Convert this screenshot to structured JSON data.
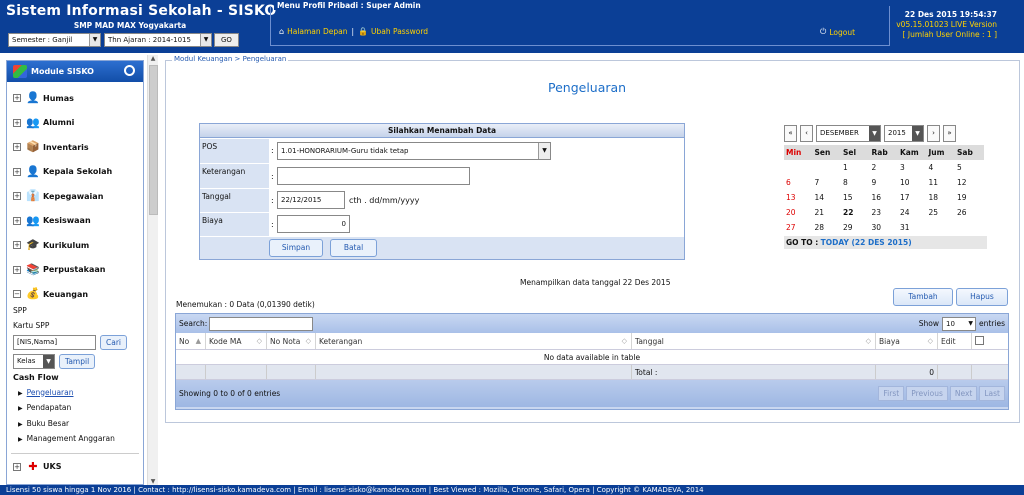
{
  "header": {
    "title": "Sistem Informasi Sekolah - SISKO",
    "school": "SMP MAD MAX Yogyakarta",
    "semester": "Semester : Ganjil",
    "tahun": "Thn Ajaran : 2014-1015",
    "go": "GO",
    "menu_title": "Menu Profil Pribadi : Super Admin",
    "home": "Halaman Depan",
    "sep": "|",
    "password": "Ubah Password",
    "logout": "Logout",
    "datetime": "22 Des 2015 19:54:37",
    "version": "v05.15.01023 LIVE Version",
    "online": "[ Jumlah User Online : 1 ]"
  },
  "sidebar": {
    "title": "Module SISKO",
    "items": [
      {
        "label": "Humas",
        "icon": "person-icon"
      },
      {
        "label": "Alumni",
        "icon": "people-icon"
      },
      {
        "label": "Inventaris",
        "icon": "boxes-icon"
      },
      {
        "label": "Kepala Sekolah",
        "icon": "person-icon"
      },
      {
        "label": "Kepegawaian",
        "icon": "staff-icon"
      },
      {
        "label": "Kesiswaan",
        "icon": "students-icon"
      },
      {
        "label": "Kurikulum",
        "icon": "graduation-icon"
      },
      {
        "label": "Perpustakaan",
        "icon": "library-icon"
      }
    ],
    "keuangan": "Keuangan",
    "spp": "SPP",
    "kartu": "Kartu SPP",
    "nis_value": "[NIS,Nama]",
    "cari": "Cari",
    "kelas": "Kelas",
    "tampil": "Tampil",
    "cashflow": "Cash Flow",
    "cf": [
      "Pengeluaran",
      "Pendapatan",
      "Buku Besar",
      "Management Anggaran"
    ],
    "uks": "UKS"
  },
  "breadcrumb": "Modul Keuangan > Pengeluaran",
  "page_title": "Pengeluaran",
  "form": {
    "title": "Silahkan Menambah Data",
    "pos_label": "POS",
    "pos_value": "1.01-HONORARIUM-Guru tidak tetap",
    "ket_label": "Keterangan",
    "tgl_label": "Tanggal",
    "tgl_value": "22/12/2015",
    "tgl_hint": "cth . dd/mm/yyyy",
    "biaya_label": "Biaya",
    "biaya_value": "0",
    "colon": ":",
    "save": "Simpan",
    "cancel": "Batal"
  },
  "calendar": {
    "prev_year": "«",
    "prev": "‹",
    "month": "DESEMBER",
    "year": "2015",
    "next": "›",
    "next_year": "»",
    "days": [
      "Min",
      "Sen",
      "Sel",
      "Rab",
      "Kam",
      "Jum",
      "Sab"
    ],
    "weeks": [
      [
        "",
        "",
        "1",
        "2",
        "3",
        "4",
        "5"
      ],
      [
        "6",
        "7",
        "8",
        "9",
        "10",
        "11",
        "12"
      ],
      [
        "13",
        "14",
        "15",
        "16",
        "17",
        "18",
        "19"
      ],
      [
        "20",
        "21",
        "22",
        "23",
        "24",
        "25",
        "26"
      ],
      [
        "27",
        "28",
        "29",
        "30",
        "31",
        "",
        ""
      ]
    ],
    "goto": "GO TO :",
    "today": "TODAY (22 DES 2015)"
  },
  "note": "Menampilkan data tanggal 22 Des 2015",
  "found": "Menemukan : 0 Data (0,01390 detik)",
  "actions": {
    "add": "Tambah",
    "delete": "Hapus"
  },
  "table": {
    "search": "Search:",
    "show": "Show",
    "entries_val": "10",
    "entries": "entries",
    "headers": [
      "No",
      "Kode MA",
      "No Nota",
      "Keterangan",
      "Tanggal",
      "Biaya",
      "Edit"
    ],
    "empty": "No data available in table",
    "total_label": "Total :",
    "total_value": "0",
    "info": "Showing 0 to 0 of 0 entries",
    "pages": [
      "First",
      "Previous",
      "Next",
      "Last"
    ]
  },
  "footer": "Lisensi 50 siswa hingga 1 Nov 2016   |   Contact : http://lisensi-sisko.kamadeva.com   |   Email : lisensi-sisko@kamadeva.com   |   Best Viewed : Mozilla, Chrome, Safari, Opera   |   Copyright © KAMADEVA, 2014"
}
